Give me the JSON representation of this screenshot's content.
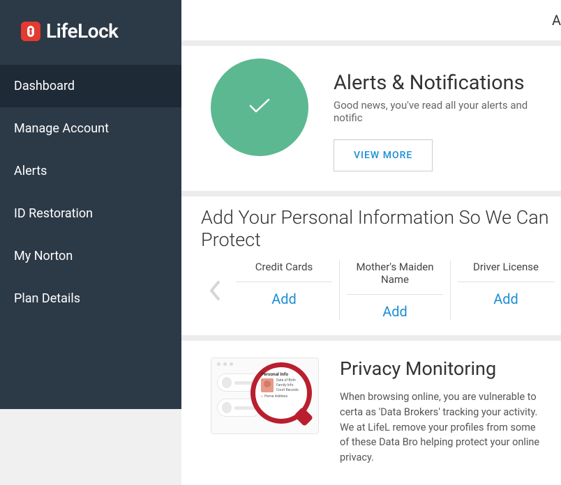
{
  "brand": {
    "name": "LifeLock"
  },
  "topbar": {
    "partial": "A"
  },
  "nav": {
    "items": [
      {
        "label": "Dashboard",
        "active": true
      },
      {
        "label": "Manage Account",
        "active": false
      },
      {
        "label": "Alerts",
        "active": false
      },
      {
        "label": "ID Restoration",
        "active": false
      },
      {
        "label": "My Norton",
        "active": false
      },
      {
        "label": "Plan Details",
        "active": false
      }
    ]
  },
  "alerts_card": {
    "title": "Alerts & Notifications",
    "subtitle": "Good news, you've read all your alerts and notific",
    "button": "VIEW MORE",
    "status": "ok"
  },
  "personal_card": {
    "title": "Add Your Personal Information So We Can Protect ",
    "add_label": "Add",
    "items": [
      {
        "label": "Credit Cards"
      },
      {
        "label": "Mother's Maiden Name"
      },
      {
        "label": "Driver License"
      }
    ]
  },
  "privacy_card": {
    "title": "Privacy Monitoring",
    "body": "When browsing online, you are vulnerable to certa as 'Data Brokers' tracking your activity. We at LifeL remove your profiles from some of these Data Bro helping protect your online privacy.",
    "illustration": {
      "header": "Personal Info",
      "lines": [
        "Date of Birth",
        "Family Info",
        "Court Records"
      ],
      "home": "Home Address"
    }
  },
  "colors": {
    "accent": "#1a8ed6",
    "sidebar": "#2c3947",
    "sidebar_active": "#1e2a36",
    "brand_red": "#e43a2f",
    "status_green": "#5cb891",
    "magnifier": "#b91f2e"
  }
}
